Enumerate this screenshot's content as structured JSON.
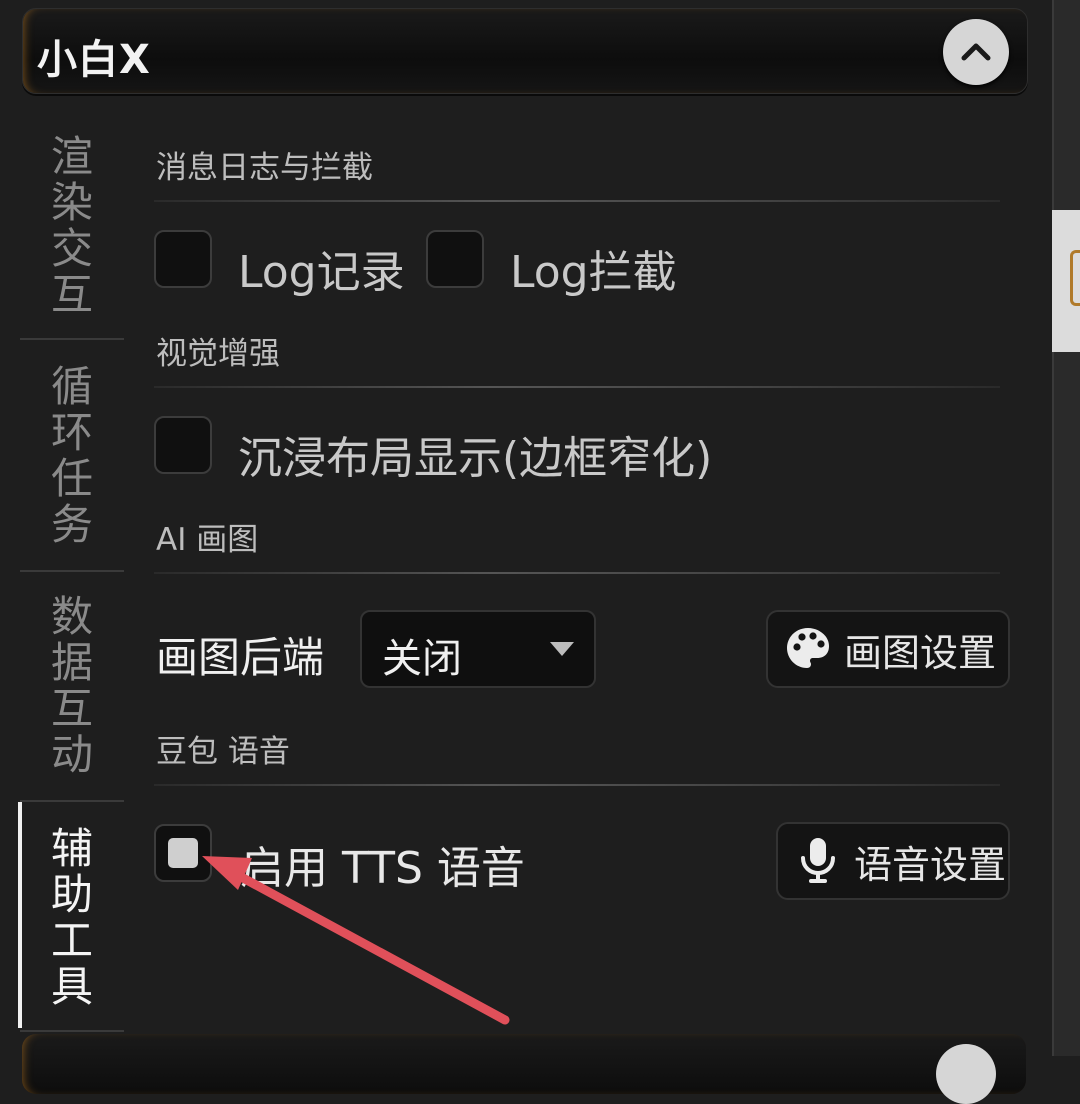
{
  "header": {
    "title": "小白X"
  },
  "tabs": [
    {
      "label": "渲染交互",
      "chars": [
        "渲",
        "染",
        "交",
        "互"
      ],
      "active": false
    },
    {
      "label": "循环任务",
      "chars": [
        "循",
        "环",
        "任",
        "务"
      ],
      "active": false
    },
    {
      "label": "数据互动",
      "chars": [
        "数",
        "据",
        "互",
        "动"
      ],
      "active": false
    },
    {
      "label": "辅助工具",
      "chars": [
        "辅",
        "助",
        "工",
        "具"
      ],
      "active": true
    }
  ],
  "sections": {
    "log": {
      "title": "消息日志与拦截",
      "log_record": {
        "label": "Log记录",
        "checked": false
      },
      "log_intercept": {
        "label": "Log拦截",
        "checked": false
      }
    },
    "visual": {
      "title": "视觉增强",
      "immersive": {
        "label": "沉浸布局显示(边框窄化)",
        "checked": false
      }
    },
    "ai_draw": {
      "title": "AI 画图",
      "backend_label": "画图后端",
      "backend_value": "关闭",
      "settings_button": "画图设置",
      "settings_icon": "palette-icon"
    },
    "doubao": {
      "title": "豆包 语音",
      "tts": {
        "label": "启用 TTS 语音",
        "checked": true
      },
      "settings_button": "语音设置",
      "settings_icon": "microphone-icon"
    }
  },
  "colors": {
    "accent_glow": "#8a5a1c",
    "annotation_arrow": "#e0505a"
  }
}
